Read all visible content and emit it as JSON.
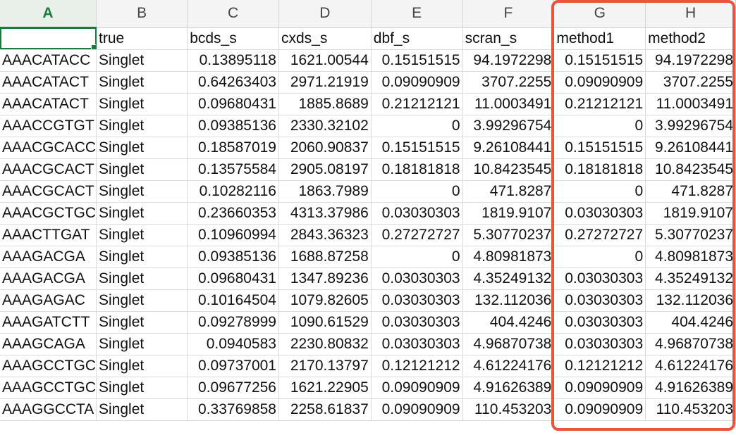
{
  "colors": {
    "highlight": "#e8553a",
    "selection": "#1d7a3f",
    "grid": "#dcdcdc",
    "header_bg": "#f4f4f4"
  },
  "column_letters": [
    "A",
    "B",
    "C",
    "D",
    "E",
    "F",
    "G",
    "H"
  ],
  "active_column": "A",
  "header_row": [
    "",
    "true",
    "bcds_s",
    "cxds_s",
    "dbf_s",
    "scran_s",
    "method1",
    "method2"
  ],
  "rows": [
    [
      "AAACATACC",
      "Singlet",
      "0.13895118",
      "1621.00544",
      "0.15151515",
      "94.1972298",
      "0.15151515",
      "94.1972298"
    ],
    [
      "AAACATACT",
      "Singlet",
      "0.64263403",
      "2971.21919",
      "0.09090909",
      "3707.2255",
      "0.09090909",
      "3707.2255"
    ],
    [
      "AAACATACT",
      "Singlet",
      "0.09680431",
      "1885.8689",
      "0.21212121",
      "11.0003491",
      "0.21212121",
      "11.0003491"
    ],
    [
      "AAACCGTGT",
      "Singlet",
      "0.09385136",
      "2330.32102",
      "0",
      "3.99296754",
      "0",
      "3.99296754"
    ],
    [
      "AAACGCACC",
      "Singlet",
      "0.18587019",
      "2060.90837",
      "0.15151515",
      "9.26108441",
      "0.15151515",
      "9.26108441"
    ],
    [
      "AAACGCACT",
      "Singlet",
      "0.13575584",
      "2905.08197",
      "0.18181818",
      "10.8423545",
      "0.18181818",
      "10.8423545"
    ],
    [
      "AAACGCACT",
      "Singlet",
      "0.10282116",
      "1863.7989",
      "0",
      "471.8287",
      "0",
      "471.8287"
    ],
    [
      "AAACGCTGC",
      "Singlet",
      "0.23660353",
      "4313.37986",
      "0.03030303",
      "1819.9107",
      "0.03030303",
      "1819.9107"
    ],
    [
      "AAACTTGAT",
      "Singlet",
      "0.10960994",
      "2843.36323",
      "0.27272727",
      "5.30770237",
      "0.27272727",
      "5.30770237"
    ],
    [
      "AAAGACGA",
      "Singlet",
      "0.09385136",
      "1688.87258",
      "0",
      "4.80981873",
      "0",
      "4.80981873"
    ],
    [
      "AAAGACGA",
      "Singlet",
      "0.09680431",
      "1347.89236",
      "0.03030303",
      "4.35249132",
      "0.03030303",
      "4.35249132"
    ],
    [
      "AAAGAGAC",
      "Singlet",
      "0.10164504",
      "1079.82605",
      "0.03030303",
      "132.112036",
      "0.03030303",
      "132.112036"
    ],
    [
      "AAAGATCTT",
      "Singlet",
      "0.09278999",
      "1090.61529",
      "0.03030303",
      "404.4246",
      "0.03030303",
      "404.4246"
    ],
    [
      "AAAGCAGA",
      "Singlet",
      "0.0940583",
      "2230.80832",
      "0.03030303",
      "4.96870738",
      "0.03030303",
      "4.96870738"
    ],
    [
      "AAAGCCTGC",
      "Singlet",
      "0.09737001",
      "2170.13797",
      "0.12121212",
      "4.61224176",
      "0.12121212",
      "4.61224176"
    ],
    [
      "AAAGCCTGC",
      "Singlet",
      "0.09677256",
      "1621.22905",
      "0.09090909",
      "4.91626389",
      "0.09090909",
      "4.91626389"
    ],
    [
      "AAAGGCCTA",
      "Singlet",
      "0.33769858",
      "2258.61837",
      "0.09090909",
      "110.453203",
      "0.09090909",
      "110.453203"
    ]
  ]
}
